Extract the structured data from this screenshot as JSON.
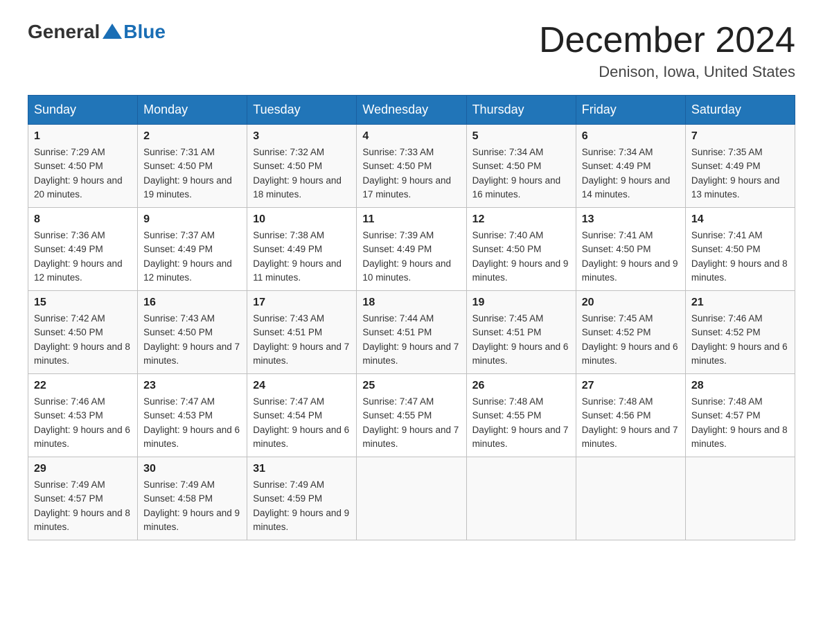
{
  "header": {
    "logo_general": "General",
    "logo_blue": "Blue",
    "month_title": "December 2024",
    "location": "Denison, Iowa, United States"
  },
  "days_of_week": [
    "Sunday",
    "Monday",
    "Tuesday",
    "Wednesday",
    "Thursday",
    "Friday",
    "Saturday"
  ],
  "weeks": [
    [
      {
        "day": "1",
        "sunrise": "7:29 AM",
        "sunset": "4:50 PM",
        "daylight": "9 hours and 20 minutes."
      },
      {
        "day": "2",
        "sunrise": "7:31 AM",
        "sunset": "4:50 PM",
        "daylight": "9 hours and 19 minutes."
      },
      {
        "day": "3",
        "sunrise": "7:32 AM",
        "sunset": "4:50 PM",
        "daylight": "9 hours and 18 minutes."
      },
      {
        "day": "4",
        "sunrise": "7:33 AM",
        "sunset": "4:50 PM",
        "daylight": "9 hours and 17 minutes."
      },
      {
        "day": "5",
        "sunrise": "7:34 AM",
        "sunset": "4:50 PM",
        "daylight": "9 hours and 16 minutes."
      },
      {
        "day": "6",
        "sunrise": "7:34 AM",
        "sunset": "4:49 PM",
        "daylight": "9 hours and 14 minutes."
      },
      {
        "day": "7",
        "sunrise": "7:35 AM",
        "sunset": "4:49 PM",
        "daylight": "9 hours and 13 minutes."
      }
    ],
    [
      {
        "day": "8",
        "sunrise": "7:36 AM",
        "sunset": "4:49 PM",
        "daylight": "9 hours and 12 minutes."
      },
      {
        "day": "9",
        "sunrise": "7:37 AM",
        "sunset": "4:49 PM",
        "daylight": "9 hours and 12 minutes."
      },
      {
        "day": "10",
        "sunrise": "7:38 AM",
        "sunset": "4:49 PM",
        "daylight": "9 hours and 11 minutes."
      },
      {
        "day": "11",
        "sunrise": "7:39 AM",
        "sunset": "4:49 PM",
        "daylight": "9 hours and 10 minutes."
      },
      {
        "day": "12",
        "sunrise": "7:40 AM",
        "sunset": "4:50 PM",
        "daylight": "9 hours and 9 minutes."
      },
      {
        "day": "13",
        "sunrise": "7:41 AM",
        "sunset": "4:50 PM",
        "daylight": "9 hours and 9 minutes."
      },
      {
        "day": "14",
        "sunrise": "7:41 AM",
        "sunset": "4:50 PM",
        "daylight": "9 hours and 8 minutes."
      }
    ],
    [
      {
        "day": "15",
        "sunrise": "7:42 AM",
        "sunset": "4:50 PM",
        "daylight": "9 hours and 8 minutes."
      },
      {
        "day": "16",
        "sunrise": "7:43 AM",
        "sunset": "4:50 PM",
        "daylight": "9 hours and 7 minutes."
      },
      {
        "day": "17",
        "sunrise": "7:43 AM",
        "sunset": "4:51 PM",
        "daylight": "9 hours and 7 minutes."
      },
      {
        "day": "18",
        "sunrise": "7:44 AM",
        "sunset": "4:51 PM",
        "daylight": "9 hours and 7 minutes."
      },
      {
        "day": "19",
        "sunrise": "7:45 AM",
        "sunset": "4:51 PM",
        "daylight": "9 hours and 6 minutes."
      },
      {
        "day": "20",
        "sunrise": "7:45 AM",
        "sunset": "4:52 PM",
        "daylight": "9 hours and 6 minutes."
      },
      {
        "day": "21",
        "sunrise": "7:46 AM",
        "sunset": "4:52 PM",
        "daylight": "9 hours and 6 minutes."
      }
    ],
    [
      {
        "day": "22",
        "sunrise": "7:46 AM",
        "sunset": "4:53 PM",
        "daylight": "9 hours and 6 minutes."
      },
      {
        "day": "23",
        "sunrise": "7:47 AM",
        "sunset": "4:53 PM",
        "daylight": "9 hours and 6 minutes."
      },
      {
        "day": "24",
        "sunrise": "7:47 AM",
        "sunset": "4:54 PM",
        "daylight": "9 hours and 6 minutes."
      },
      {
        "day": "25",
        "sunrise": "7:47 AM",
        "sunset": "4:55 PM",
        "daylight": "9 hours and 7 minutes."
      },
      {
        "day": "26",
        "sunrise": "7:48 AM",
        "sunset": "4:55 PM",
        "daylight": "9 hours and 7 minutes."
      },
      {
        "day": "27",
        "sunrise": "7:48 AM",
        "sunset": "4:56 PM",
        "daylight": "9 hours and 7 minutes."
      },
      {
        "day": "28",
        "sunrise": "7:48 AM",
        "sunset": "4:57 PM",
        "daylight": "9 hours and 8 minutes."
      }
    ],
    [
      {
        "day": "29",
        "sunrise": "7:49 AM",
        "sunset": "4:57 PM",
        "daylight": "9 hours and 8 minutes."
      },
      {
        "day": "30",
        "sunrise": "7:49 AM",
        "sunset": "4:58 PM",
        "daylight": "9 hours and 9 minutes."
      },
      {
        "day": "31",
        "sunrise": "7:49 AM",
        "sunset": "4:59 PM",
        "daylight": "9 hours and 9 minutes."
      },
      null,
      null,
      null,
      null
    ]
  ]
}
